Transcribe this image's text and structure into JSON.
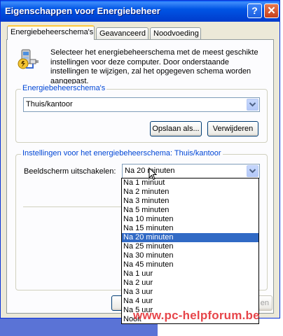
{
  "window": {
    "title": "Eigenschappen voor Energiebeheer",
    "help_glyph": "?",
    "close_glyph": "✕"
  },
  "tabs": [
    {
      "label": "Energiebeheerschema's",
      "active": true
    },
    {
      "label": "Geavanceerd",
      "active": false
    },
    {
      "label": "Noodvoeding",
      "active": false
    }
  ],
  "description": "Selecteer het energiebeheerschema met de meest geschikte instellingen voor deze computer. Door onderstaande instellingen te wijzigen, zal het opgegeven schema worden aangepast.",
  "schemes_group": {
    "label": "Energiebeheerschema's",
    "selected": "Thuis/kantoor",
    "save_button": "Opslaan als...",
    "delete_button": "Verwijderen"
  },
  "settings_group": {
    "label": "Instellingen voor het energiebeheerschema: Thuis/kantoor",
    "monitor_label": "Beeldscherm uitschakelen:",
    "monitor_value": "Na 20 minuten"
  },
  "dropdown_options": [
    "Na 1 minuut",
    "Na 2 minuten",
    "Na 3 minuten",
    "Na 5 minuten",
    "Na 10 minuten",
    "Na 15 minuten",
    "Na 20 minuten",
    "Na 25 minuten",
    "Na 30 minuten",
    "Na 45 minuten",
    "Na 1 uur",
    "Na 2 uur",
    "Na 3 uur",
    "Na 4 uur",
    "Na 5 uur",
    "Nooit"
  ],
  "dropdown_selected_index": 6,
  "footer": {
    "hidden_button_fragment": "en"
  },
  "watermark": "www.pc-helpforum.be",
  "colors": {
    "titlebar": "#0055e5",
    "selection": "#316ac5",
    "group_label": "#0046d5",
    "watermark": "#e7454a"
  },
  "icons": [
    "power-options-icon",
    "help-icon",
    "close-icon",
    "chevron-down-icon",
    "mouse-cursor-icon"
  ]
}
